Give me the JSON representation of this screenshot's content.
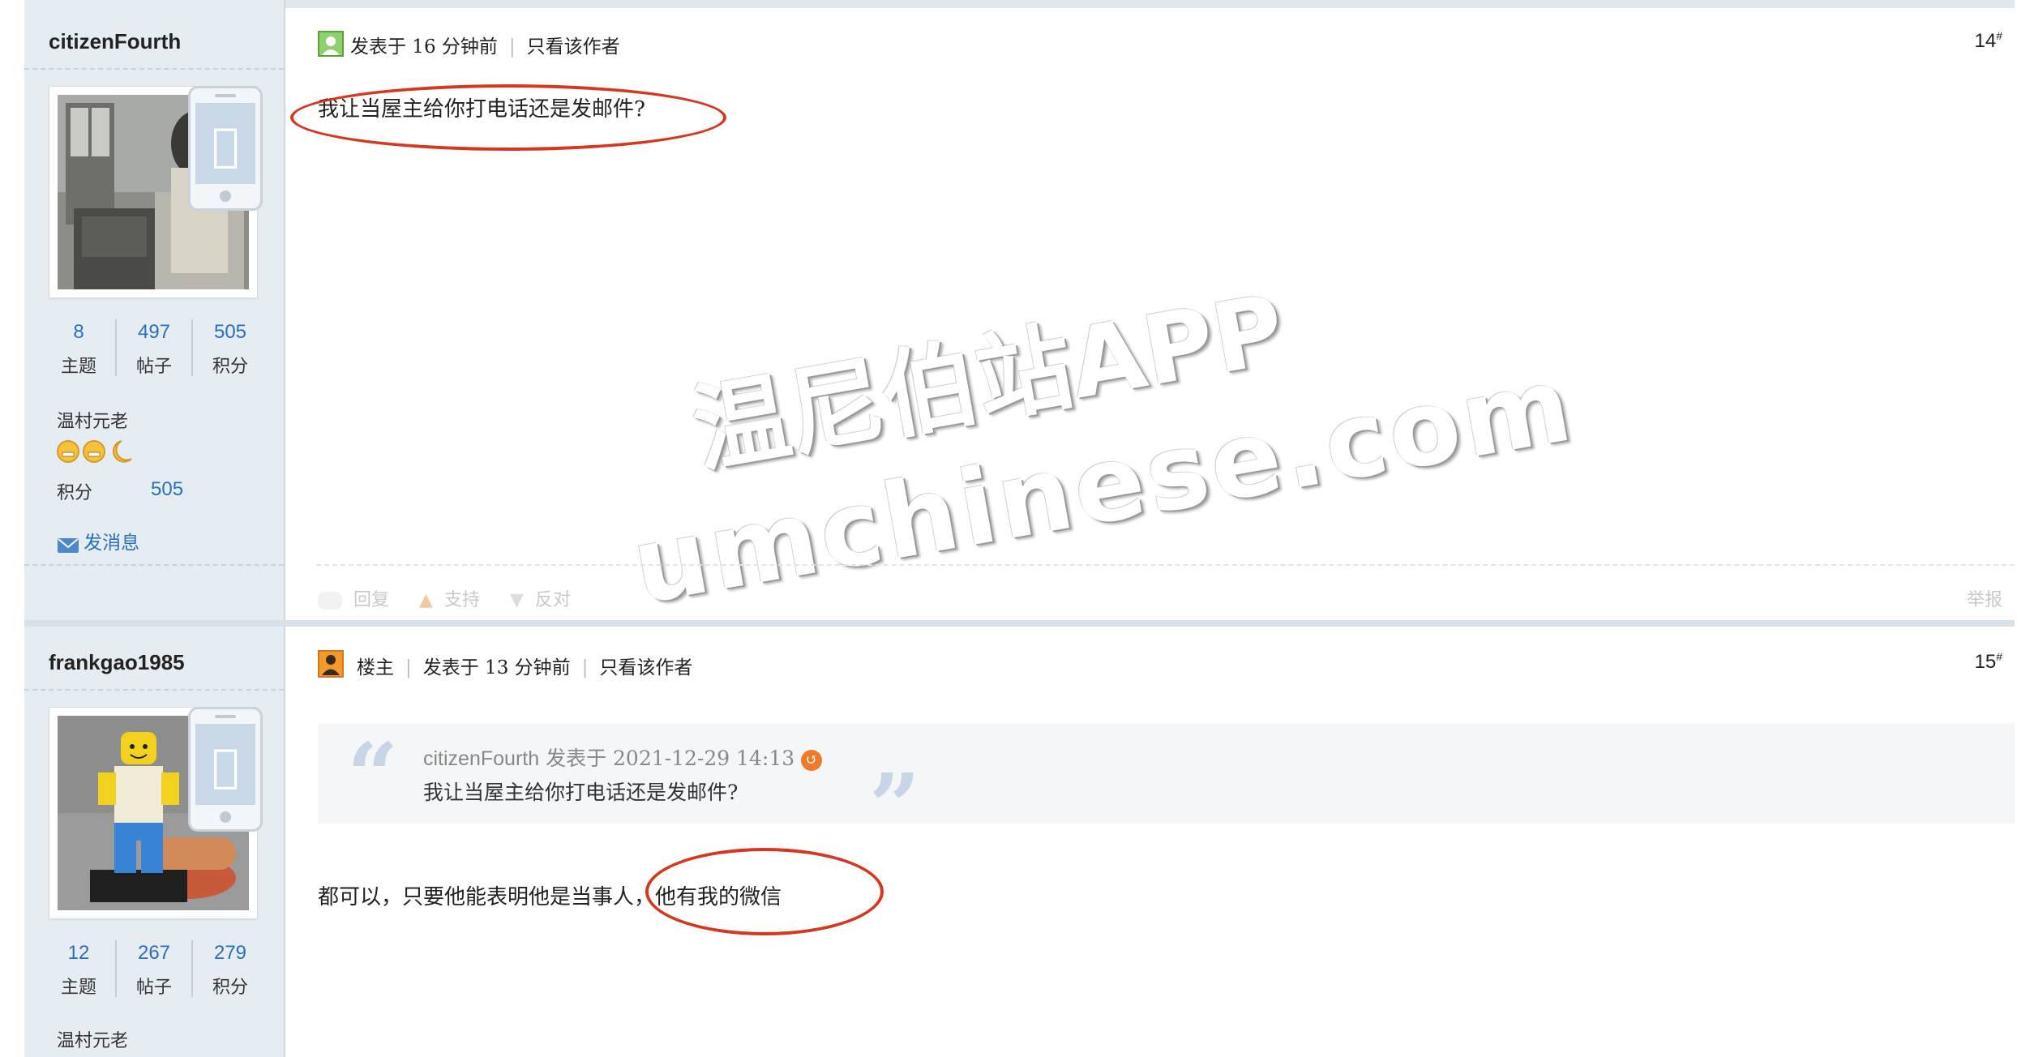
{
  "posts": [
    {
      "username": "citizenFourth",
      "stats": [
        {
          "value": "8",
          "label": "主题"
        },
        {
          "value": "497",
          "label": "帖子"
        },
        {
          "value": "505",
          "label": "积分"
        }
      ],
      "rank": "温村元老",
      "points_label": "积分",
      "points_value": "505",
      "send_message": "发消息",
      "posted": "发表于 16 分钟前",
      "only_author": "只看该作者",
      "floor": "14",
      "floor_mark": "#",
      "content": "我让当屋主给你打电话还是发邮件?",
      "actions": {
        "reply": "回复",
        "support": "支持",
        "oppose": "反对",
        "report": "举报"
      }
    },
    {
      "username": "frankgao1985",
      "stats": [
        {
          "value": "12",
          "label": "主题"
        },
        {
          "value": "267",
          "label": "帖子"
        },
        {
          "value": "279",
          "label": "积分"
        }
      ],
      "rank": "温村元老",
      "op_badge": "楼主",
      "posted": "发表于 13 分钟前",
      "only_author": "只看该作者",
      "floor": "15",
      "floor_mark": "#",
      "quote": {
        "author": "citizenFourth",
        "meta": "发表于 2021-12-29 14:13",
        "text": "我让当屋主给你打电话还是发邮件?"
      },
      "content": "都可以，只要他能表明他是当事人，他有我的微信"
    }
  ],
  "watermark": {
    "line1": "温尼伯站APP",
    "line2": "umchinese.com"
  },
  "colors": {
    "link": "#2a6fbf",
    "annotation": "#d7361f",
    "sidebar": "#e5edf2"
  }
}
